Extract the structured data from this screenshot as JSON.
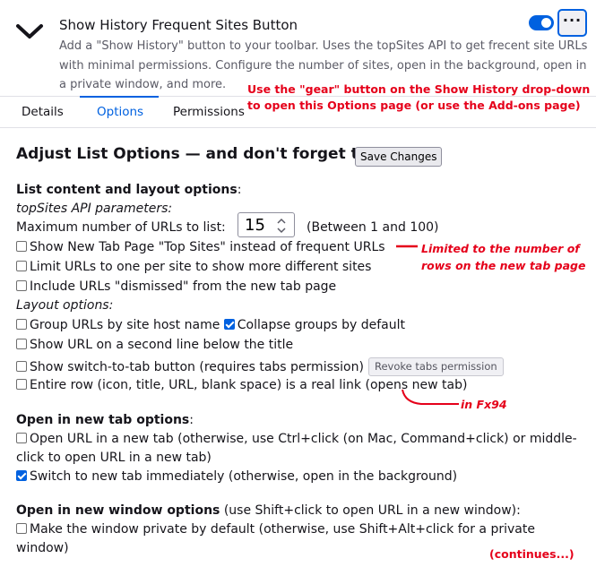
{
  "header": {
    "addon_title": "Show History Frequent Sites Button",
    "addon_description": "Add a \"Show History\" button to your toolbar. Uses the topSites API to get frecent site URLs with minimal permissions. Configure the number of sites, open in the background, open in a private window, and more.",
    "enabled": true,
    "more_label": "···"
  },
  "tabs": [
    {
      "label": "Details",
      "active": false
    },
    {
      "label": "Options",
      "active": true
    },
    {
      "label": "Permissions",
      "active": false
    }
  ],
  "annotations": {
    "gear_line1": "Use the \"gear\" button on the Show History drop-down",
    "gear_line2": "to open this Options page (or use the Add-ons page)",
    "top_sites_line1": "Limited to the number of",
    "top_sites_line2": "rows on the new tab page",
    "fx94": "in Fx94",
    "continues": "(continues...)"
  },
  "options": {
    "heading": "Adjust List Options — and don't forget to",
    "save_label": "Save Changes",
    "list_section": {
      "title": "List content and layout options",
      "title_suffix": ":",
      "api_params_label": "topSites API parameters:",
      "max_urls_label": "Maximum number of URLs to list:",
      "max_urls_value": "15",
      "max_urls_range": "(Between 1 and 100)",
      "items": [
        {
          "label": "Show New Tab Page \"Top Sites\" instead of frequent URLs",
          "checked": false
        },
        {
          "label": "Limit URLs to one per site to show more different sites",
          "checked": false
        },
        {
          "label": "Include URLs \"dismissed\" from the new tab page",
          "checked": false
        }
      ],
      "layout_label": "Layout options:",
      "group_label": "Group URLs by site host name",
      "group_checked": false,
      "collapse_label": "Collapse groups by default",
      "collapse_checked": true,
      "show_url_label": "Show URL on a second line below the title",
      "show_url_checked": false,
      "switch_tab_label": "Show switch-to-tab button (requires tabs permission)",
      "switch_tab_checked": false,
      "revoke_label": "Revoke tabs permission",
      "entire_row_label": "Entire row (icon, title, URL, blank space) is a real link (opens new tab)",
      "entire_row_checked": false
    },
    "new_tab_section": {
      "title": "Open in new tab options",
      "title_suffix": ":",
      "open_new_tab_line1": "Open URL in a new tab (otherwise, use Ctrl+click (on Mac, Command+click) or middle-",
      "open_new_tab_line2": "click to open URL in a new tab)",
      "open_new_tab_checked": false,
      "switch_immediately_label": "Switch to new tab immediately (otherwise, open in the background)",
      "switch_immediately_checked": true
    },
    "new_window_section": {
      "title": "Open in new window options",
      "title_suffix": " (use Shift+click to open URL in a new window):",
      "private_line1": "Make the window private by default (otherwise, use Shift+Alt+click for a private",
      "private_line2": "window)",
      "private_checked": false
    }
  }
}
